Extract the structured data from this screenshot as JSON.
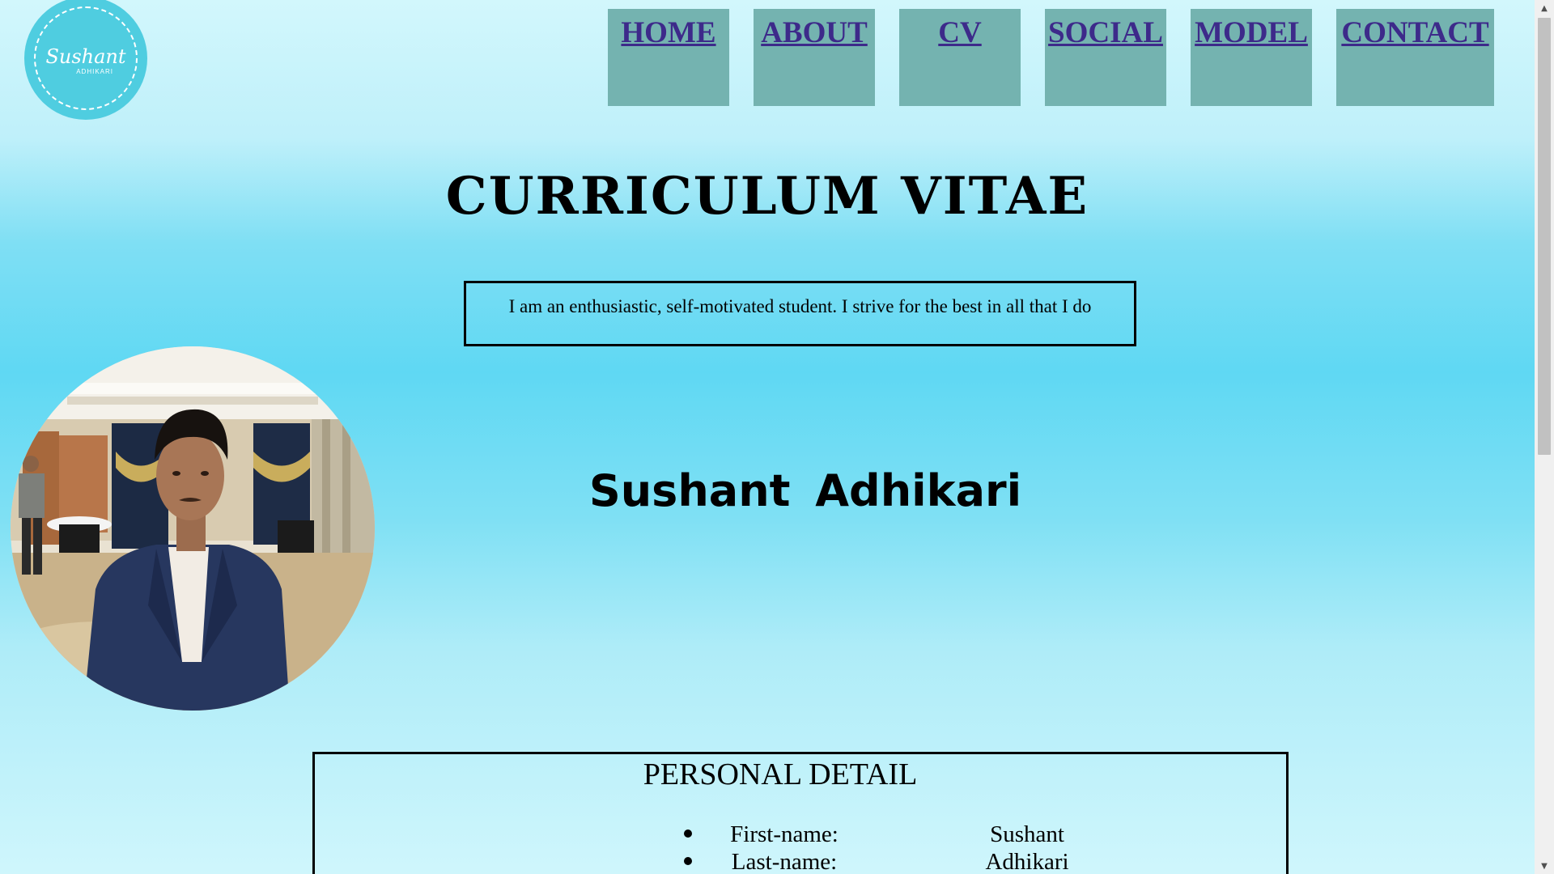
{
  "logo": {
    "script_text": "Sushant",
    "sub_text": "ADHIKARI",
    "color": "#4fcde0"
  },
  "nav": {
    "items": [
      {
        "label": "HOME"
      },
      {
        "label": "ABOUT"
      },
      {
        "label": "CV"
      },
      {
        "label": "SOCIAL"
      },
      {
        "label": "MODEL"
      },
      {
        "label": "CONTACT"
      }
    ],
    "box_color": "#74b3b0",
    "link_color": "#3d2a8a"
  },
  "main": {
    "title": "CURRICULUM VITAE",
    "tagline": "I am an enthusiastic, self-motivated student. I strive for the best in all that I do",
    "name": "Sushant  Adhikari"
  },
  "personal_detail": {
    "heading": "PERSONAL DETAIL",
    "rows": [
      {
        "label": "First-name:",
        "value": "Sushant"
      },
      {
        "label": "Last-name:",
        "value": "Adhikari"
      }
    ]
  },
  "scrollbar": {
    "up_icon": "triangle-up-icon",
    "down_icon": "triangle-down-icon"
  }
}
